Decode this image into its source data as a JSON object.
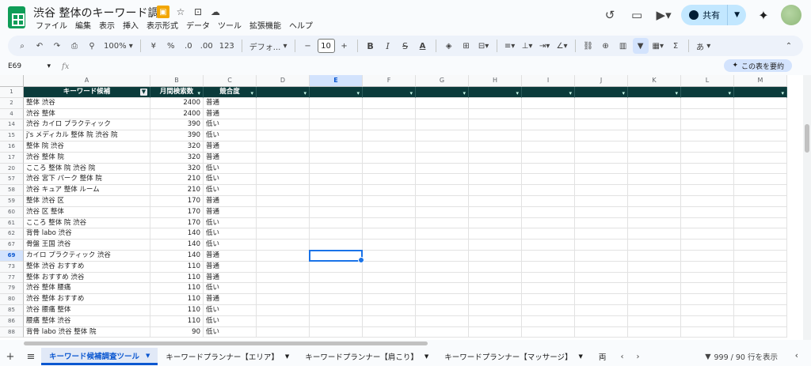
{
  "app": {
    "title": "渋谷 整体のキーワード調査",
    "menus": [
      "ファイル",
      "編集",
      "表示",
      "挿入",
      "表示形式",
      "データ",
      "ツール",
      "拡張機能",
      "ヘルプ"
    ],
    "share_label": "共有"
  },
  "toolbar": {
    "zoom": "100%",
    "currency": "¥",
    "percent": "%",
    "dec_decrease": ".0",
    "dec_increase": ".00",
    "number_format": "123",
    "font": "デフォ...",
    "font_size": "10",
    "input_lang": "あ"
  },
  "formula_bar": {
    "cell_ref": "E69",
    "fx": "fx",
    "summarize_label": "この表を要約"
  },
  "grid": {
    "columns": [
      "A",
      "B",
      "C",
      "D",
      "E",
      "F",
      "G",
      "H",
      "I",
      "J",
      "K",
      "L",
      "M"
    ],
    "selected_column": "E",
    "selected_row": "69",
    "header_row_number": "1",
    "header": [
      "キーワード候補",
      "月間検索数",
      "競合度"
    ],
    "rows": [
      {
        "n": "2",
        "kw": "整体 渋谷",
        "vol": "2400",
        "comp": "普通"
      },
      {
        "n": "4",
        "kw": "渋谷 整体",
        "vol": "2400",
        "comp": "普通"
      },
      {
        "n": "14",
        "kw": "渋谷 カイロ プラクティック",
        "vol": "390",
        "comp": "低い"
      },
      {
        "n": "15",
        "kw": "j's メディカル 整体 院 渋谷 院",
        "vol": "390",
        "comp": "低い"
      },
      {
        "n": "16",
        "kw": "整体 院 渋谷",
        "vol": "320",
        "comp": "普通"
      },
      {
        "n": "17",
        "kw": "渋谷 整体 院",
        "vol": "320",
        "comp": "普通"
      },
      {
        "n": "20",
        "kw": "こころ 整体 院 渋谷 院",
        "vol": "320",
        "comp": "低い"
      },
      {
        "n": "57",
        "kw": "渋谷 宮下 パーク 整体 院",
        "vol": "210",
        "comp": "低い"
      },
      {
        "n": "58",
        "kw": "渋谷 キュア 整体 ルーム",
        "vol": "210",
        "comp": "低い"
      },
      {
        "n": "59",
        "kw": "整体 渋谷 区",
        "vol": "170",
        "comp": "普通"
      },
      {
        "n": "60",
        "kw": "渋谷 区 整体",
        "vol": "170",
        "comp": "普通"
      },
      {
        "n": "61",
        "kw": "こころ 整体 院 渋谷",
        "vol": "170",
        "comp": "低い"
      },
      {
        "n": "62",
        "kw": "背骨 labo 渋谷",
        "vol": "140",
        "comp": "低い"
      },
      {
        "n": "67",
        "kw": "骨盤 王国 渋谷",
        "vol": "140",
        "comp": "低い"
      },
      {
        "n": "69",
        "kw": "カイロ プラクティック 渋谷",
        "vol": "140",
        "comp": "普通"
      },
      {
        "n": "73",
        "kw": "整体 渋谷 おすすめ",
        "vol": "110",
        "comp": "普通"
      },
      {
        "n": "77",
        "kw": "整体 おすすめ 渋谷",
        "vol": "110",
        "comp": "普通"
      },
      {
        "n": "79",
        "kw": "渋谷 整体 腰痛",
        "vol": "110",
        "comp": "低い"
      },
      {
        "n": "80",
        "kw": "渋谷 整体 おすすめ",
        "vol": "110",
        "comp": "普通"
      },
      {
        "n": "85",
        "kw": "渋谷 腰痛 整体",
        "vol": "110",
        "comp": "低い"
      },
      {
        "n": "86",
        "kw": "腰痛 整体 渋谷",
        "vol": "110",
        "comp": "低い"
      },
      {
        "n": "88",
        "kw": "背骨 labo 渋谷 整体 院",
        "vol": "90",
        "comp": "低い"
      }
    ]
  },
  "sheets": {
    "tabs": [
      "キーワード候補調査ツール",
      "キーワードプランナー【エリア】",
      "キーワードプランナー【肩こり】",
      "キーワードプランナー【マッサージ】",
      "両"
    ],
    "active_index": 0,
    "row_count": "999 / 90 行を表示"
  },
  "colors": {
    "header_bg": "#0b3b3b",
    "accent": "#0b57d0",
    "selection": "#1a73e8",
    "share_bg": "#c2e7ff"
  }
}
